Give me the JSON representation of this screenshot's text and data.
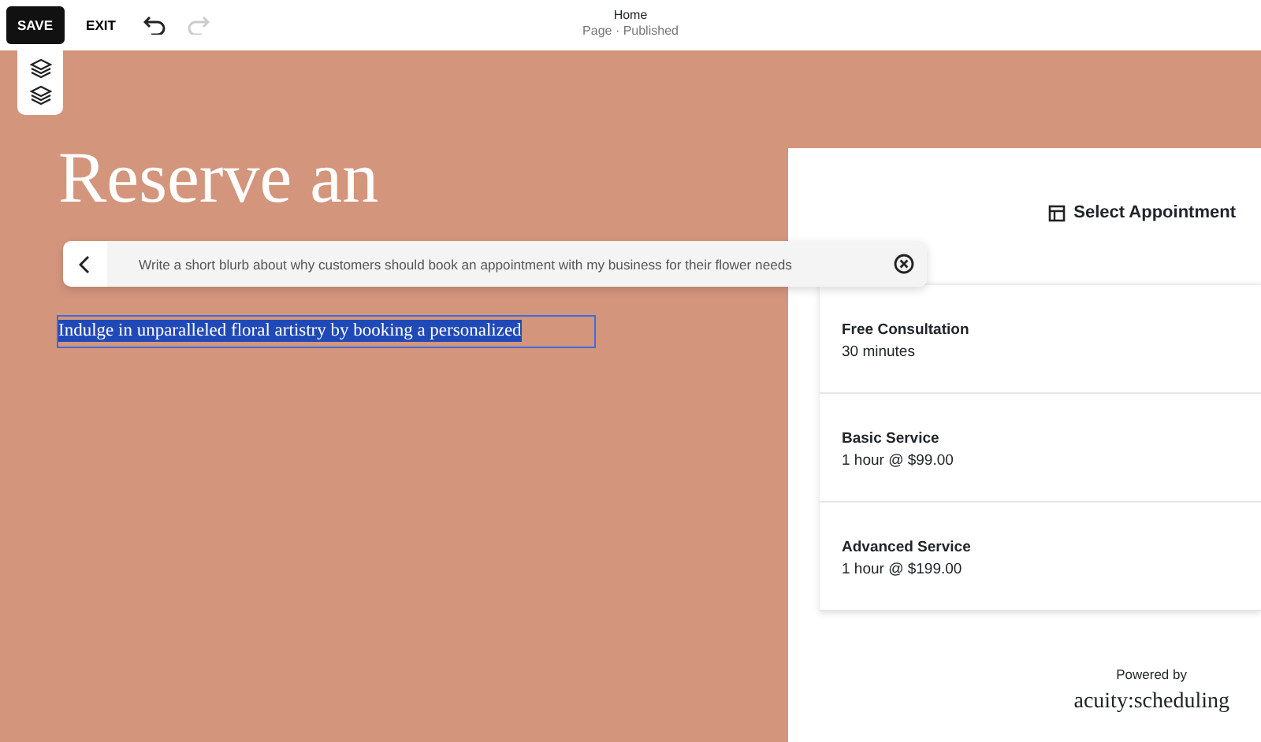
{
  "toolbar": {
    "save": "SAVE",
    "exit": "EXIT",
    "undo_disabled": false,
    "redo_disabled": true
  },
  "page": {
    "title": "Home",
    "status": "Page · Published"
  },
  "hero": {
    "heading": "Reserve an",
    "selected_text": "Indulge in unparalleled floral artistry by booking a personalized"
  },
  "prompt": {
    "value": "Write a short blurb about why customers should book an appointment with my business for their flower needs"
  },
  "scheduler": {
    "header": "Select Appointment",
    "services": [
      {
        "name": "Free Consultation",
        "detail": "30 minutes"
      },
      {
        "name": "Basic Service",
        "detail": "1 hour @ $99.00"
      },
      {
        "name": "Advanced Service",
        "detail": "1 hour @ $199.00"
      }
    ],
    "powered_by": "Powered by",
    "brand": "acuity:scheduling"
  }
}
